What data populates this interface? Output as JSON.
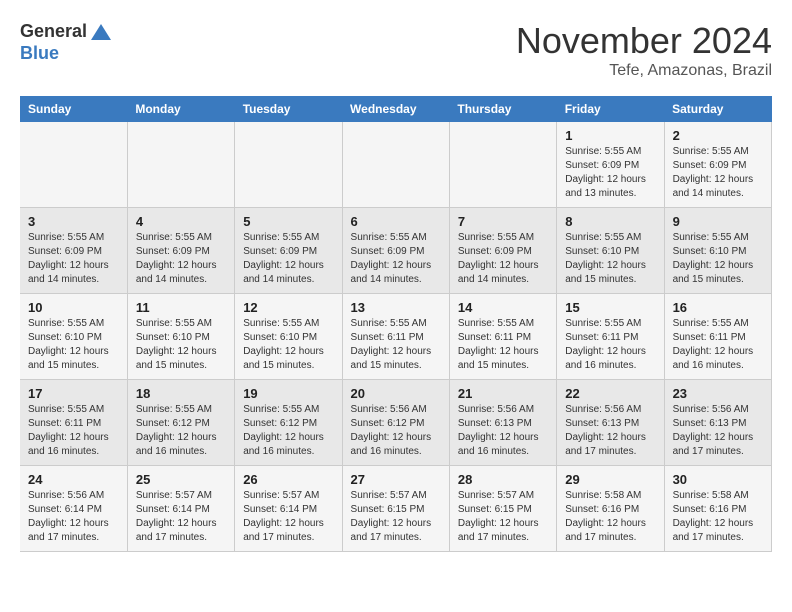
{
  "logo": {
    "general": "General",
    "blue": "Blue"
  },
  "title": "November 2024",
  "location": "Tefe, Amazonas, Brazil",
  "days_of_week": [
    "Sunday",
    "Monday",
    "Tuesday",
    "Wednesday",
    "Thursday",
    "Friday",
    "Saturday"
  ],
  "weeks": [
    [
      {
        "day": "",
        "info": ""
      },
      {
        "day": "",
        "info": ""
      },
      {
        "day": "",
        "info": ""
      },
      {
        "day": "",
        "info": ""
      },
      {
        "day": "",
        "info": ""
      },
      {
        "day": "1",
        "info": "Sunrise: 5:55 AM\nSunset: 6:09 PM\nDaylight: 12 hours and 13 minutes."
      },
      {
        "day": "2",
        "info": "Sunrise: 5:55 AM\nSunset: 6:09 PM\nDaylight: 12 hours and 14 minutes."
      }
    ],
    [
      {
        "day": "3",
        "info": "Sunrise: 5:55 AM\nSunset: 6:09 PM\nDaylight: 12 hours and 14 minutes."
      },
      {
        "day": "4",
        "info": "Sunrise: 5:55 AM\nSunset: 6:09 PM\nDaylight: 12 hours and 14 minutes."
      },
      {
        "day": "5",
        "info": "Sunrise: 5:55 AM\nSunset: 6:09 PM\nDaylight: 12 hours and 14 minutes."
      },
      {
        "day": "6",
        "info": "Sunrise: 5:55 AM\nSunset: 6:09 PM\nDaylight: 12 hours and 14 minutes."
      },
      {
        "day": "7",
        "info": "Sunrise: 5:55 AM\nSunset: 6:09 PM\nDaylight: 12 hours and 14 minutes."
      },
      {
        "day": "8",
        "info": "Sunrise: 5:55 AM\nSunset: 6:10 PM\nDaylight: 12 hours and 15 minutes."
      },
      {
        "day": "9",
        "info": "Sunrise: 5:55 AM\nSunset: 6:10 PM\nDaylight: 12 hours and 15 minutes."
      }
    ],
    [
      {
        "day": "10",
        "info": "Sunrise: 5:55 AM\nSunset: 6:10 PM\nDaylight: 12 hours and 15 minutes."
      },
      {
        "day": "11",
        "info": "Sunrise: 5:55 AM\nSunset: 6:10 PM\nDaylight: 12 hours and 15 minutes."
      },
      {
        "day": "12",
        "info": "Sunrise: 5:55 AM\nSunset: 6:10 PM\nDaylight: 12 hours and 15 minutes."
      },
      {
        "day": "13",
        "info": "Sunrise: 5:55 AM\nSunset: 6:11 PM\nDaylight: 12 hours and 15 minutes."
      },
      {
        "day": "14",
        "info": "Sunrise: 5:55 AM\nSunset: 6:11 PM\nDaylight: 12 hours and 15 minutes."
      },
      {
        "day": "15",
        "info": "Sunrise: 5:55 AM\nSunset: 6:11 PM\nDaylight: 12 hours and 16 minutes."
      },
      {
        "day": "16",
        "info": "Sunrise: 5:55 AM\nSunset: 6:11 PM\nDaylight: 12 hours and 16 minutes."
      }
    ],
    [
      {
        "day": "17",
        "info": "Sunrise: 5:55 AM\nSunset: 6:11 PM\nDaylight: 12 hours and 16 minutes."
      },
      {
        "day": "18",
        "info": "Sunrise: 5:55 AM\nSunset: 6:12 PM\nDaylight: 12 hours and 16 minutes."
      },
      {
        "day": "19",
        "info": "Sunrise: 5:55 AM\nSunset: 6:12 PM\nDaylight: 12 hours and 16 minutes."
      },
      {
        "day": "20",
        "info": "Sunrise: 5:56 AM\nSunset: 6:12 PM\nDaylight: 12 hours and 16 minutes."
      },
      {
        "day": "21",
        "info": "Sunrise: 5:56 AM\nSunset: 6:13 PM\nDaylight: 12 hours and 16 minutes."
      },
      {
        "day": "22",
        "info": "Sunrise: 5:56 AM\nSunset: 6:13 PM\nDaylight: 12 hours and 17 minutes."
      },
      {
        "day": "23",
        "info": "Sunrise: 5:56 AM\nSunset: 6:13 PM\nDaylight: 12 hours and 17 minutes."
      }
    ],
    [
      {
        "day": "24",
        "info": "Sunrise: 5:56 AM\nSunset: 6:14 PM\nDaylight: 12 hours and 17 minutes."
      },
      {
        "day": "25",
        "info": "Sunrise: 5:57 AM\nSunset: 6:14 PM\nDaylight: 12 hours and 17 minutes."
      },
      {
        "day": "26",
        "info": "Sunrise: 5:57 AM\nSunset: 6:14 PM\nDaylight: 12 hours and 17 minutes."
      },
      {
        "day": "27",
        "info": "Sunrise: 5:57 AM\nSunset: 6:15 PM\nDaylight: 12 hours and 17 minutes."
      },
      {
        "day": "28",
        "info": "Sunrise: 5:57 AM\nSunset: 6:15 PM\nDaylight: 12 hours and 17 minutes."
      },
      {
        "day": "29",
        "info": "Sunrise: 5:58 AM\nSunset: 6:16 PM\nDaylight: 12 hours and 17 minutes."
      },
      {
        "day": "30",
        "info": "Sunrise: 5:58 AM\nSunset: 6:16 PM\nDaylight: 12 hours and 17 minutes."
      }
    ]
  ]
}
